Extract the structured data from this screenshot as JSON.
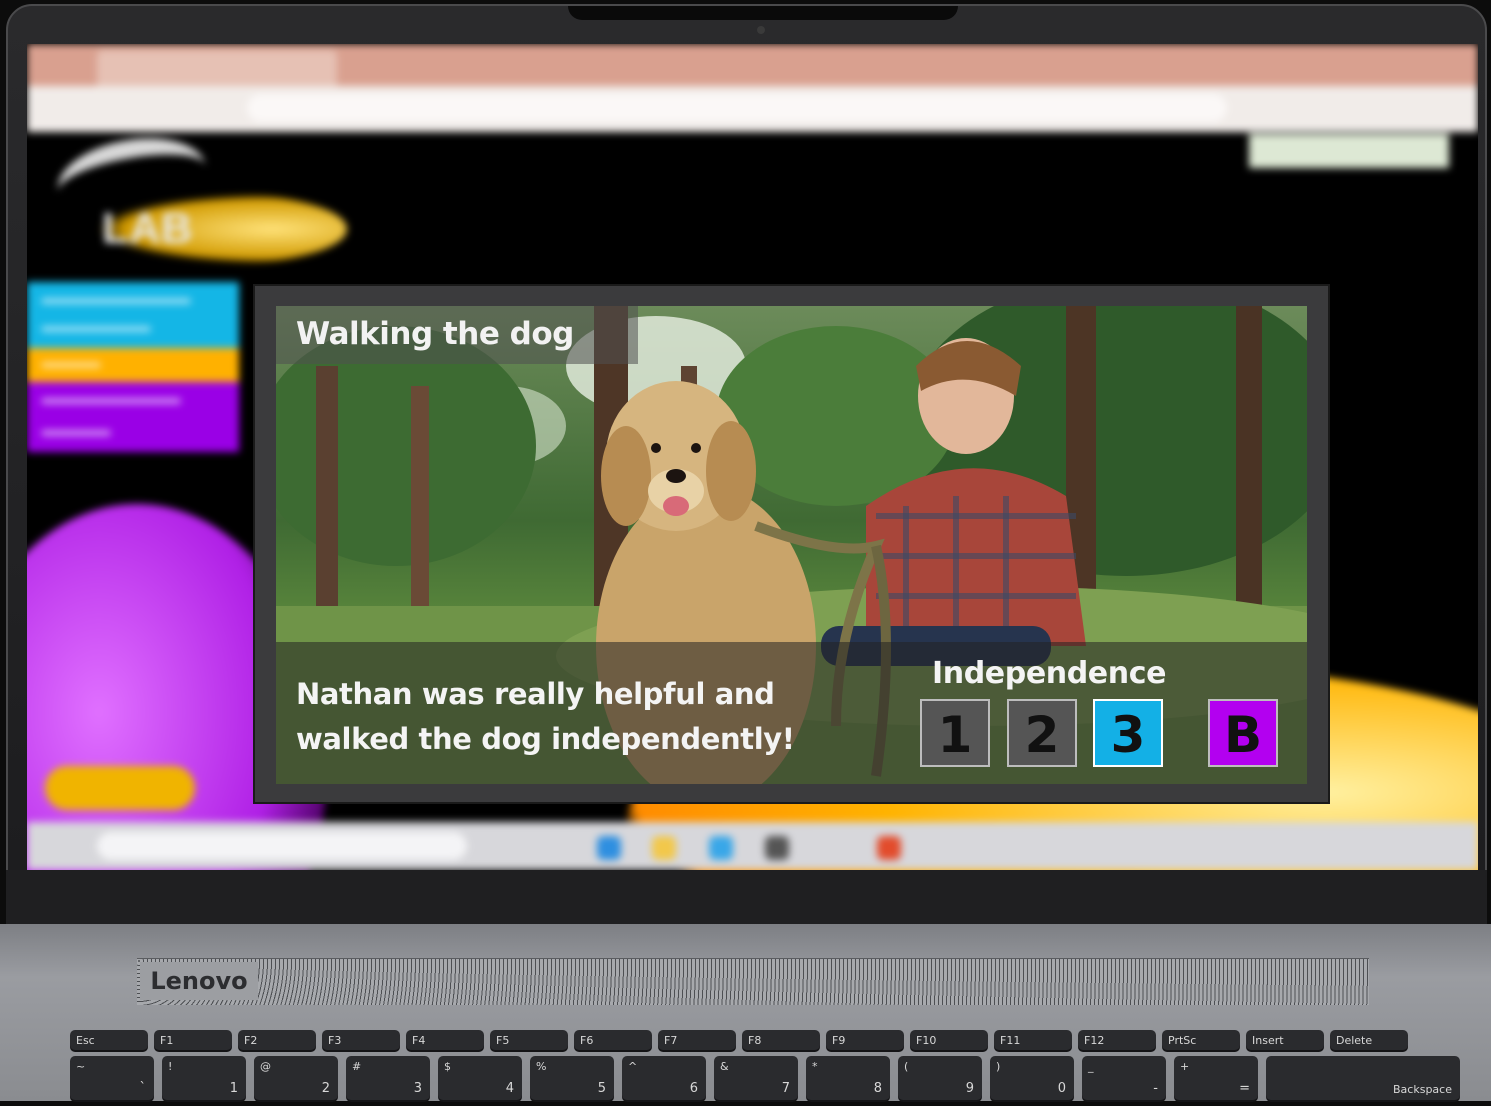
{
  "device": {
    "brand": "Lenovo"
  },
  "card": {
    "title": "Walking the dog",
    "caption_line1": "Nathan was really helpful and",
    "caption_line2": "walked the dog independently!",
    "independence_label": "Independence",
    "scores": [
      {
        "label": "1",
        "selected": false,
        "color": "#555555"
      },
      {
        "label": "2",
        "selected": false,
        "color": "#555555"
      },
      {
        "label": "3",
        "selected": true,
        "color": "#13b0e6"
      },
      {
        "label": "B",
        "selected": false,
        "color": "#b300f0"
      }
    ]
  },
  "keyboard": {
    "row1": [
      "Esc",
      "F1",
      "F2",
      "F3",
      "F4",
      "F5",
      "F6",
      "F7",
      "F8",
      "F9",
      "F10",
      "F11",
      "F12",
      "PrtSc",
      "Insert",
      "Delete"
    ],
    "row2_top": [
      "~",
      "!",
      "@",
      "#",
      "$",
      "%",
      "^",
      "&",
      "*",
      "(",
      ")",
      "_",
      "+"
    ],
    "row2_bottom": [
      "`",
      "1",
      "2",
      "3",
      "4",
      "5",
      "6",
      "7",
      "8",
      "9",
      "0",
      "-",
      "="
    ],
    "backspace": "Backspace"
  }
}
